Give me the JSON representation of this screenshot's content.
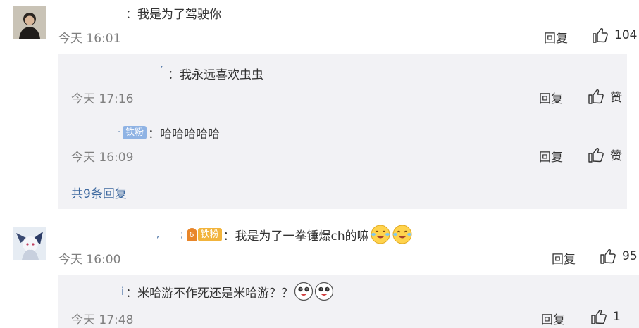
{
  "comments": [
    {
      "text": "：我是为了驾驶你",
      "time": "今天 16:01",
      "reply_label": "回复",
      "like_count": "104",
      "avatar_icon": "user-avatar-dark-suit"
    },
    {
      "text": "：我是为了一拳锤爆ch的嘛",
      "badge": "铁粉",
      "badge_level": "6",
      "time": "今天 16:00",
      "reply_label": "回复",
      "like_count": "95",
      "avatar_icon": "user-avatar-anime"
    }
  ],
  "replies": [
    {
      "text": "：我永远喜欢虫虫",
      "time": "今天 17:16",
      "reply_label": "回复",
      "like_label": "赞"
    },
    {
      "text": "：哈哈哈哈哈",
      "badge": "铁粉",
      "time": "今天 16:09",
      "reply_label": "回复",
      "like_label": "赞"
    },
    {
      "text": "：米哈游不作死还是米哈游？？",
      "time": "今天 17:48",
      "reply_label": "回复",
      "like_count": "1"
    }
  ],
  "more_replies_label": "共9条回复",
  "colors": {
    "link": "#3f6aa0",
    "reply_bg": "#f2f2f5",
    "badge_blue": "#8fb3e4",
    "badge_gold": "#f2b43c"
  },
  "icons": {
    "like": "thumbs-up-icon",
    "laugh": "laughing-tears-emoji-icon",
    "doge": "doge-emoji-icon"
  }
}
